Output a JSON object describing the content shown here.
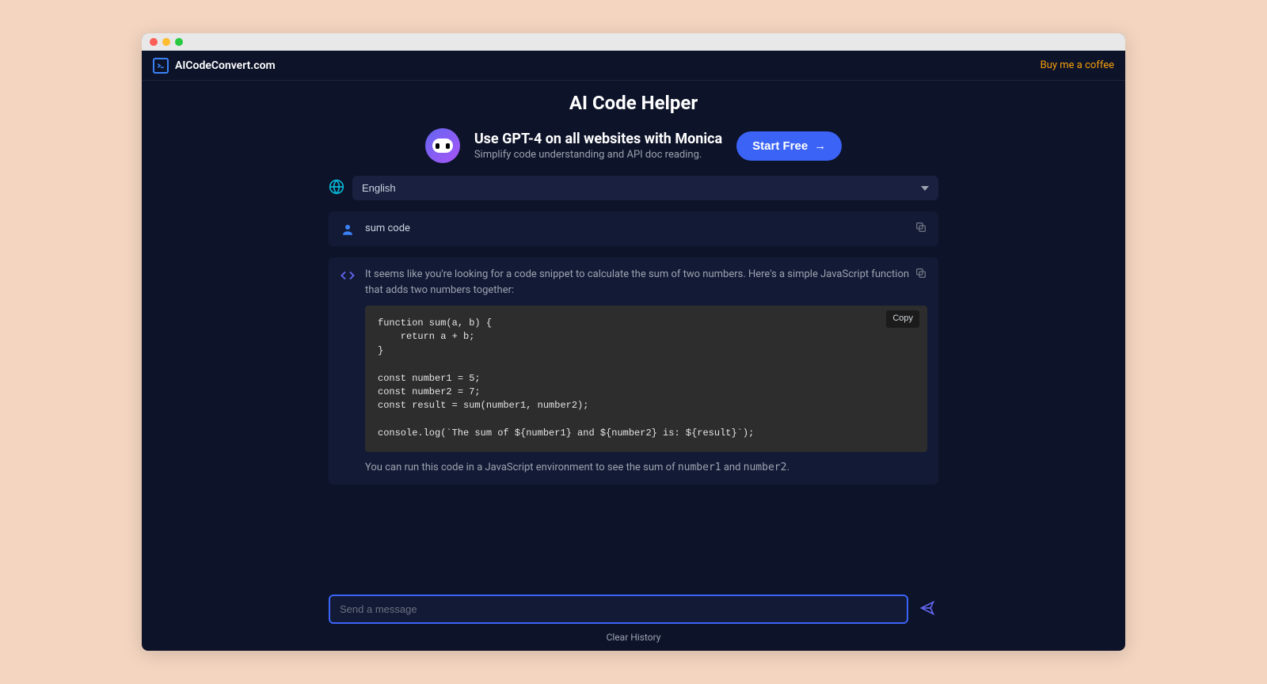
{
  "header": {
    "brand": "AICodeConvert.com",
    "coffee": "Buy me a coffee"
  },
  "page_title": "AI Code Helper",
  "promo": {
    "title": "Use GPT-4 on all websites with Monica",
    "subtitle": "Simplify code understanding and API doc reading.",
    "cta": "Start Free",
    "arrow": "→"
  },
  "language": {
    "selected": "English"
  },
  "conversation": {
    "user": "sum code",
    "assistant_intro": "It seems like you're looking for a code snippet to calculate the sum of two numbers. Here's a simple JavaScript function that adds two numbers together:",
    "code": "function sum(a, b) {\n    return a + b;\n}\n\nconst number1 = 5;\nconst number2 = 7;\nconst result = sum(number1, number2);\n\nconsole.log(`The sum of ${number1} and ${number2} is: ${result}`);",
    "code_copy_label": "Copy",
    "assistant_outro_pre": "You can run this code in a JavaScript environment to see the sum of ",
    "var1": "number1",
    "and": " and ",
    "var2": "number2",
    "period": "."
  },
  "input": {
    "placeholder": "Send a message"
  },
  "footer": {
    "clear": "Clear History"
  }
}
